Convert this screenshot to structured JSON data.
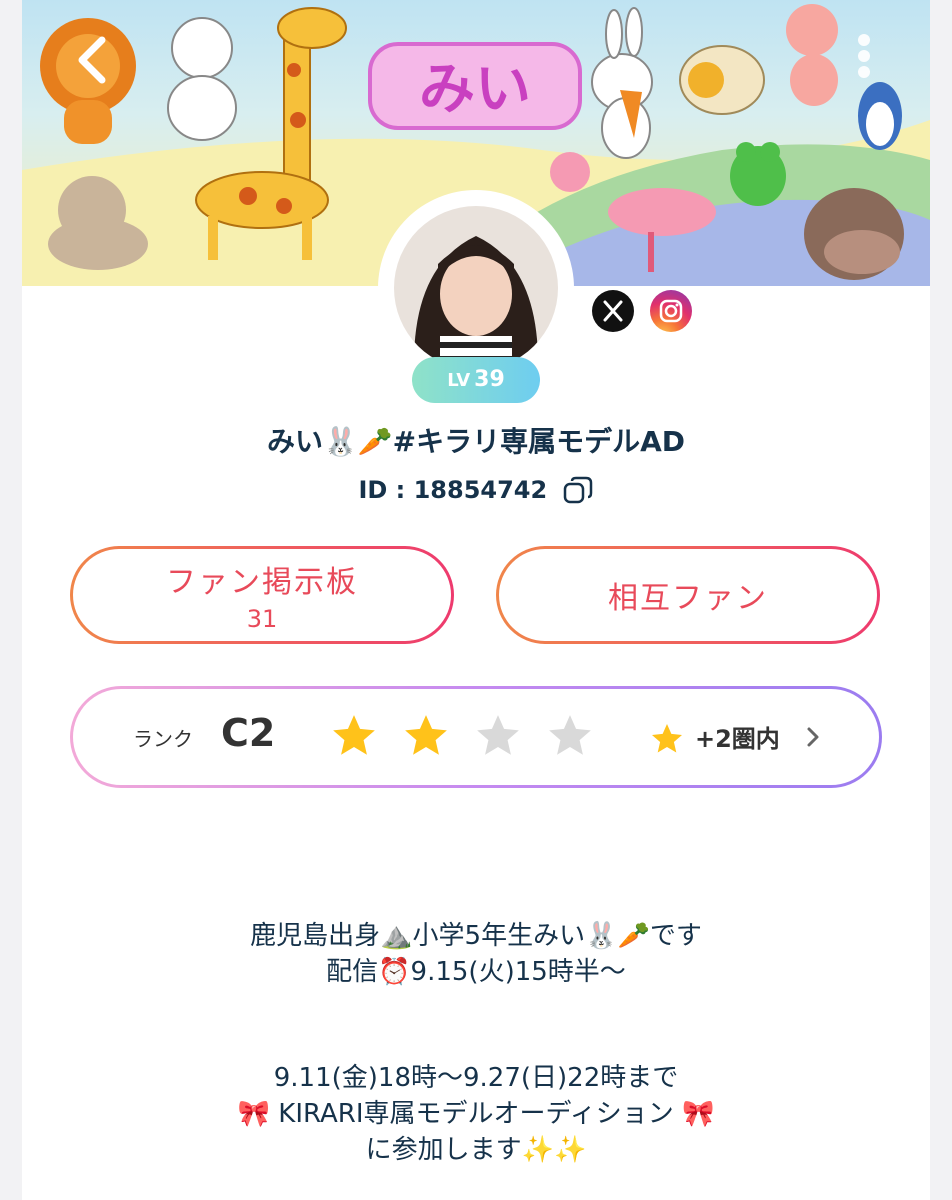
{
  "banner": {
    "title_text": "みい"
  },
  "profile": {
    "level_prefix": "LV",
    "level": "39",
    "name": "みい🐰🥕#キラリ専属モデルAD",
    "id_text": "ID : 18854742"
  },
  "buttons": {
    "fan_board_label": "ファン掲示板",
    "fan_board_count": "31",
    "mutual_fan_label": "相互ファン"
  },
  "rank": {
    "label": "ランク",
    "value": "C2",
    "stars_filled": 2,
    "stars_total": 4,
    "delta_text": "+2圏内"
  },
  "bio": {
    "line1": "鹿児島出身⛰️小学5年生みい🐰🥕です",
    "line2": "配信⏰9.15(火)15時半〜",
    "line3": "9.11(金)18時〜9.27(日)22時まで",
    "line4": "🎀 KIRARI専属モデルオーディション 🎀",
    "line5": "に参加します✨✨"
  },
  "colors": {
    "button_gradient_start": "#f0864a",
    "button_gradient_end": "#ee3a6e",
    "button_text": "#e84a5a",
    "rank_gradient_start": "#f3a9d8",
    "rank_gradient_end": "#9b7cf0",
    "star_filled": "#ffc21a",
    "star_empty": "#d9d9d9",
    "level_badge_start": "#8fe2c8",
    "level_badge_end": "#6ecdf0"
  },
  "icons": [
    "back-arrow-icon",
    "more-vertical-icon",
    "x-twitter-icon",
    "instagram-icon",
    "copy-icon",
    "star-icon",
    "chevron-right-icon"
  ]
}
